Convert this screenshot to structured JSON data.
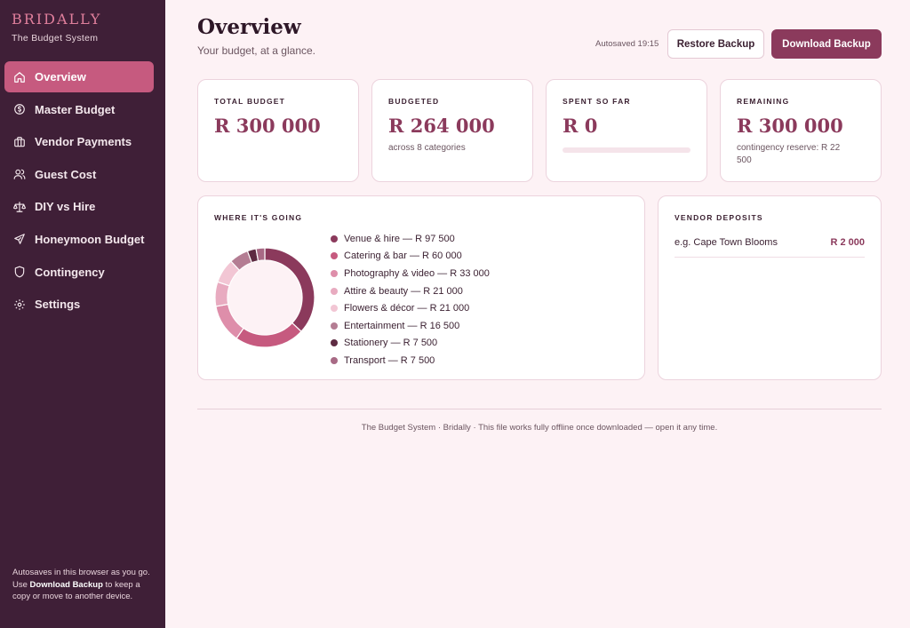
{
  "brand": {
    "name": "BRIDALLY",
    "subtitle": "The Budget System"
  },
  "nav": [
    {
      "label": "Overview",
      "icon": "home-icon",
      "active": true
    },
    {
      "label": "Master Budget",
      "icon": "coin-icon"
    },
    {
      "label": "Vendor Payments",
      "icon": "briefcase-icon"
    },
    {
      "label": "Guest Cost",
      "icon": "users-icon"
    },
    {
      "label": "DIY vs Hire",
      "icon": "scale-icon"
    },
    {
      "label": "Honeymoon Budget",
      "icon": "plane-icon"
    },
    {
      "label": "Contingency",
      "icon": "shield-icon"
    },
    {
      "label": "Settings",
      "icon": "gear-icon"
    }
  ],
  "sidebar_footer": {
    "line1": "Autosaves in this browser as you go.",
    "use": "Use ",
    "bold": "Download Backup",
    "rest": " to keep a copy or move to another device."
  },
  "header": {
    "title": "Overview",
    "subtitle": "Your budget, at a glance.",
    "autosave": "Autosaved 19:15",
    "restore_label": "Restore Backup",
    "download_label": "Download Backup"
  },
  "stats": {
    "total": {
      "label": "TOTAL BUDGET",
      "value": "R 300 000"
    },
    "budgeted": {
      "label": "BUDGETED",
      "value": "R 264 000",
      "note": "across 8 categories"
    },
    "spent": {
      "label": "SPENT SO FAR",
      "value": "R 0",
      "progress": 0
    },
    "remaining": {
      "label": "REMAINING",
      "value": "R 300 000",
      "note": "contingency reserve: R 22 500"
    }
  },
  "where": {
    "label": "WHERE IT'S GOING",
    "items": [
      {
        "label": "Venue & hire — R 97 500",
        "value": 97500,
        "color": "#8b3a5c"
      },
      {
        "label": "Catering & bar — R 60 000",
        "value": 60000,
        "color": "#c65a7f"
      },
      {
        "label": "Photography & video — R 33 000",
        "value": 33000,
        "color": "#de8eaa"
      },
      {
        "label": "Attire & beauty — R 21 000",
        "value": 21000,
        "color": "#e8abc0"
      },
      {
        "label": "Flowers & décor — R 21 000",
        "value": 21000,
        "color": "#f2c6d4"
      },
      {
        "label": "Entertainment — R 16 500",
        "value": 16500,
        "color": "#b47d93"
      },
      {
        "label": "Stationery — R 7 500",
        "value": 7500,
        "color": "#5e2b42"
      },
      {
        "label": "Transport — R 7 500",
        "value": 7500,
        "color": "#a86a85"
      }
    ]
  },
  "deposits": {
    "label": "VENDOR DEPOSITS",
    "rows": [
      {
        "name": "e.g. Cape Town Blooms",
        "amount": "R 2 000"
      }
    ]
  },
  "footer": "The Budget System · Bridally · This file works fully offline once downloaded — open it any time."
}
